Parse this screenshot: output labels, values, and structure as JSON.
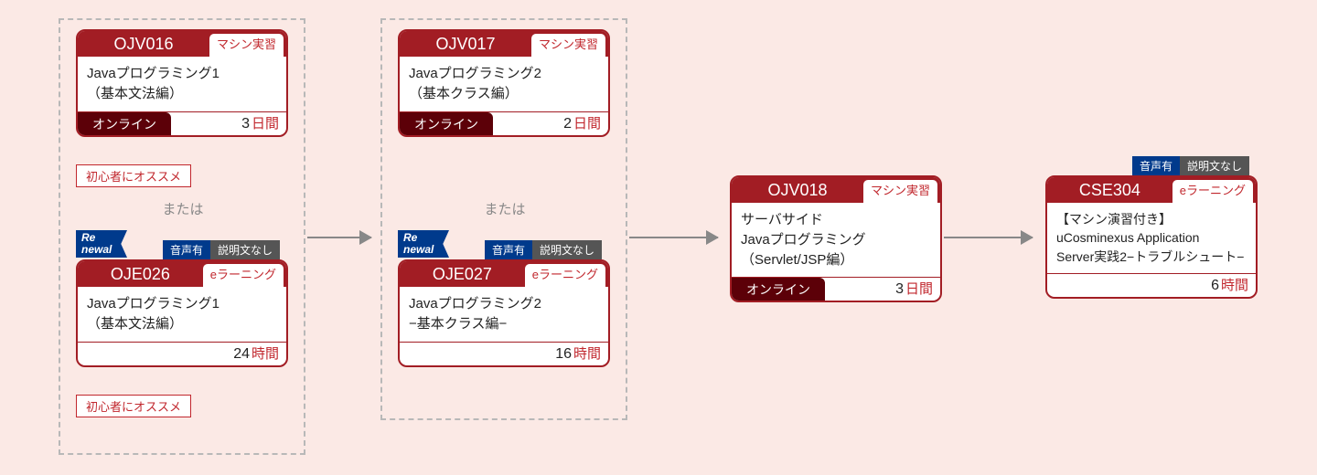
{
  "common": {
    "or_label": "または",
    "renewal_line1": "Re",
    "renewal_line2": "newal",
    "audio_left": "音声有",
    "audio_right": "説明文なし"
  },
  "cards": {
    "ojv016": {
      "code": "OJV016",
      "type": "マシン実習",
      "title_l1": "Javaプログラミング1",
      "title_l2": "（基本文法編）",
      "mode": "オンライン",
      "duration": "3",
      "unit": "日間",
      "subtag": "初心者にオススメ"
    },
    "oje026": {
      "code": "OJE026",
      "type": "eラーニング",
      "title_l1": "Javaプログラミング1",
      "title_l2": "（基本文法編）",
      "duration": "24",
      "unit": "時間",
      "subtag": "初心者にオススメ"
    },
    "ojv017": {
      "code": "OJV017",
      "type": "マシン実習",
      "title_l1": "Javaプログラミング2",
      "title_l2": "（基本クラス編）",
      "mode": "オンライン",
      "duration": "2",
      "unit": "日間"
    },
    "oje027": {
      "code": "OJE027",
      "type": "eラーニング",
      "title_l1": "Javaプログラミング2",
      "title_l2": "−基本クラス編−",
      "duration": "16",
      "unit": "時間"
    },
    "ojv018": {
      "code": "OJV018",
      "type": "マシン実習",
      "title_l1": "サーバサイド",
      "title_l2": "Javaプログラミング",
      "title_l3": "（Servlet/JSP編）",
      "mode": "オンライン",
      "duration": "3",
      "unit": "日間"
    },
    "cse304": {
      "code": "CSE304",
      "type": "eラーニング",
      "title_l1": "【マシン演習付き】",
      "title_l2": "uCosminexus Application",
      "title_l3": "Server実践2−トラブルシュート−",
      "duration": "6",
      "unit": "時間"
    }
  }
}
